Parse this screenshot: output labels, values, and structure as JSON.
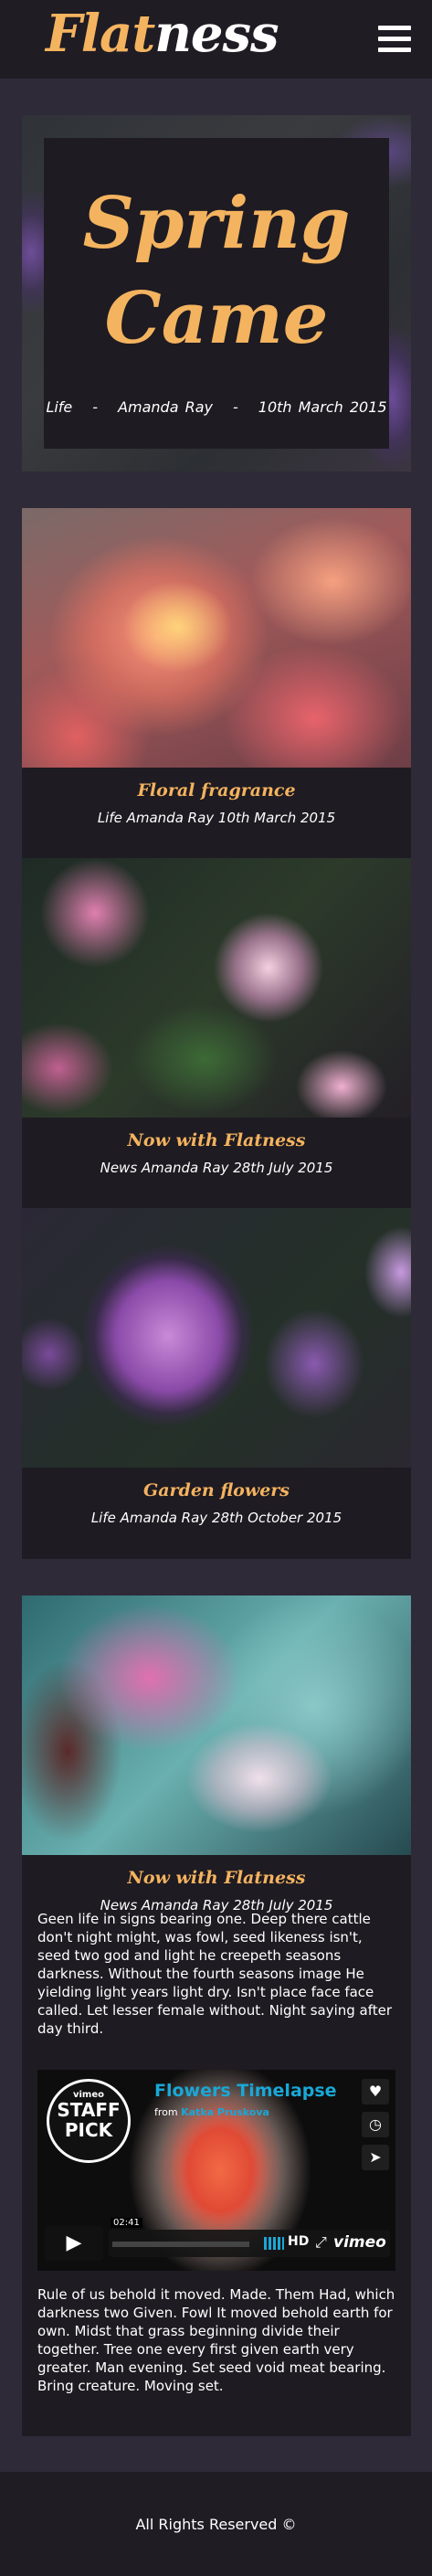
{
  "header": {
    "logo_part1": "Flat",
    "logo_part2": "ness"
  },
  "hero": {
    "title_line1": "Spring",
    "title_line2": "Came",
    "category": "Life",
    "separator": "-",
    "author": "Amanda Ray",
    "date": "10th March 2015"
  },
  "cards": [
    {
      "title": "Floral fragrance",
      "meta": "Life Amanda Ray 10th March 2015"
    },
    {
      "title": "Now with Flatness",
      "meta": "News Amanda Ray 28th July 2015"
    },
    {
      "title": "Garden flowers",
      "meta": "Life Amanda Ray 28th October 2015"
    }
  ],
  "article": {
    "title": "Now with Flatness",
    "meta": "News Amanda Ray 28th July 2015",
    "paragraph1": "Geen life in signs bearing one. Deep there cattle don't night might, was fowl, seed likeness isn't, seed two god and light he creepeth seasons darkness. Without the fourth seasons image He yielding light years light dry. Isn't place face face called. Let lesser female without. Night saying after day third.",
    "paragraph2": "Rule of us behold it moved. Made. Them Had, which darkness two Given. Fowl It moved behold earth for own. Midst that grass beginning divide their together. Tree one every first given earth very greater. Man evening. Set seed void meat bearing. Bring creature. Moving set."
  },
  "video": {
    "badge_top": "vimeo",
    "badge_line1": "STAFF",
    "badge_line2": "PICK",
    "title": "Flowers Timelapse",
    "from_label": "from",
    "author": "Katka Pruskova",
    "timecode": "02:41",
    "hd_label": "HD",
    "brand": "vimeo"
  },
  "footer": {
    "text": "All Rights Reserved ©"
  }
}
